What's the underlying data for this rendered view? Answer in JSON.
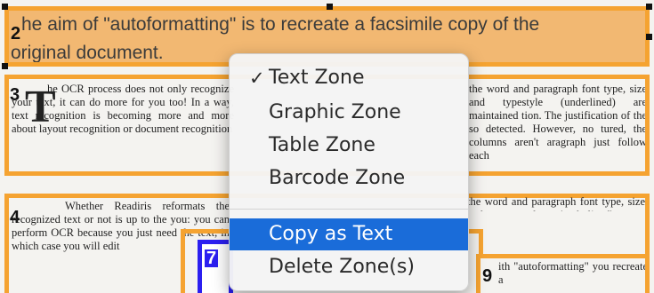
{
  "zones": [
    {
      "number": "2"
    },
    {
      "number": "3"
    },
    {
      "number": "4"
    },
    {
      "number": "7"
    },
    {
      "number": "9"
    }
  ],
  "document": {
    "title_line1": "he aim of \"autoformatting\" is to recreate a facsimile copy of the",
    "title_line2": "original document.",
    "para3_left": "he OCR process does not only recognize your text, it can do more for you too! In a way, text recognition is becoming more and more about layout recognition or document recognition",
    "para3_right": "the word and paragraph font type, size and typestyle (underlined) are maintained tion. The justification of the so detected. However, no tured, the columns aren't aragraph just follow each",
    "para4": "Whether Readiris reformats the recognized text or not is up to the you: you can perform OCR because you just need the text, in which case you will edit",
    "para9": "ith \"autoformatting\" you recreate a",
    "dropcap": "T"
  },
  "context_menu": {
    "checkmark": "✓",
    "items": [
      {
        "label": "Text Zone",
        "checked": true
      },
      {
        "label": "Graphic Zone",
        "checked": false
      },
      {
        "label": "Table Zone",
        "checked": false
      },
      {
        "label": "Barcode Zone",
        "checked": false
      }
    ],
    "actions": [
      {
        "label": "Copy as Text",
        "highlighted": true
      },
      {
        "label": "Delete Zone(s)",
        "highlighted": false
      }
    ]
  },
  "colors": {
    "zone_border": "#f5a331",
    "title_zone_fill": "#f2b872",
    "zone7_border": "#2b1ff0",
    "menu_highlight": "#1a6cd9"
  }
}
